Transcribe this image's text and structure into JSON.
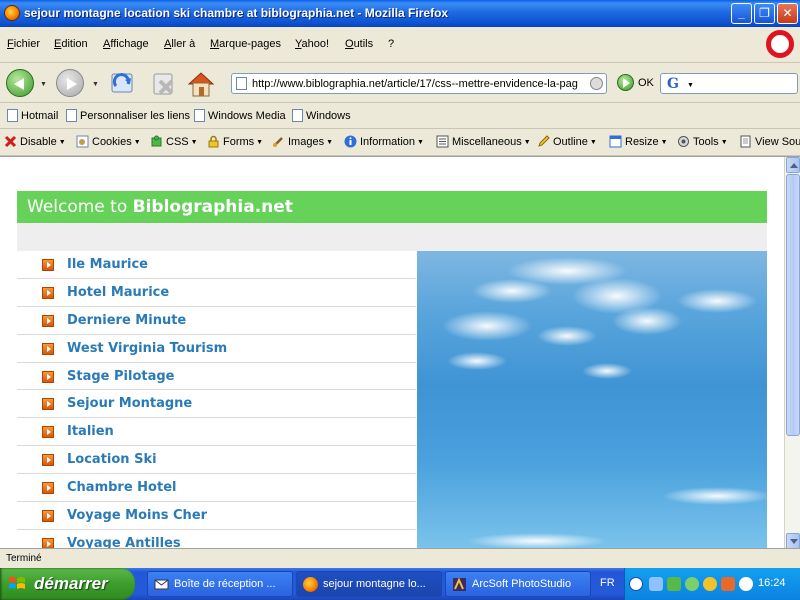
{
  "window": {
    "title": "sejour montagne location ski chambre at biblographia.net - Mozilla Firefox",
    "min_label": "_",
    "max_label": "❐",
    "close_label": "✕"
  },
  "menu": {
    "items": [
      "Fichier",
      "Edition",
      "Affichage",
      "Aller à",
      "Marque-pages",
      "Yahoo!",
      "Outils",
      "?"
    ]
  },
  "nav": {
    "url": "http://www.biblographia.net/article/17/css--mettre-envidence-la-pag",
    "go_label": "OK",
    "search_placeholder": ""
  },
  "bookmarks": {
    "items": [
      "Hotmail",
      "Personnaliser les liens",
      "Windows Media",
      "Windows"
    ]
  },
  "devtoolbar": {
    "items": [
      "Disable",
      "Cookies",
      "CSS",
      "Forms",
      "Images",
      "Information",
      "Miscellaneous",
      "Outline",
      "Resize",
      "Tools",
      "View Sou"
    ]
  },
  "site": {
    "welcome_prefix": "Welcome to ",
    "site_name": "Biblographia.net",
    "links": [
      "Ile Maurice",
      "Hotel Maurice",
      "Derniere Minute",
      "West Virginia Tourism",
      "Stage Pilotage",
      "Sejour Montagne",
      "Italien",
      "Location Ski",
      "Chambre Hotel",
      "Voyage Moins Cher",
      "Voyage Antilles"
    ]
  },
  "status": {
    "text": "Terminé"
  },
  "taskbar": {
    "start_label": "démarrer",
    "tasks": [
      "Boîte de réception ...",
      "sejour montagne lo...",
      "ArcSoft PhotoStudio"
    ],
    "language": "FR",
    "clock": "16:24"
  },
  "colors": {
    "header_green": "#67d25a",
    "link_blue": "#2a7ab8",
    "bullet_orange": "#e8751a"
  }
}
